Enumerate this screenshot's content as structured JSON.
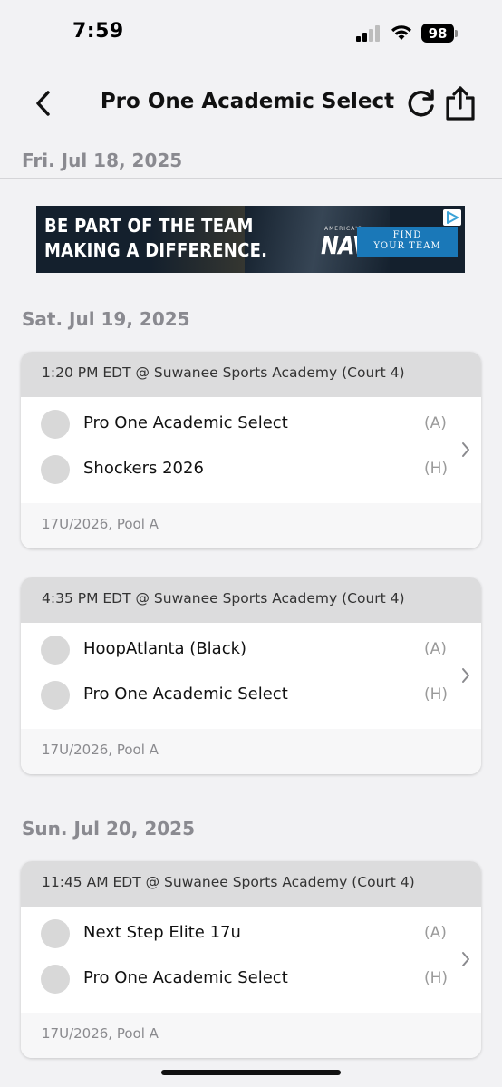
{
  "status_bar": {
    "time": "7:59",
    "battery": "98"
  },
  "nav": {
    "title": "Pro One Academic Select"
  },
  "ad": {
    "headline_line1": "BE PART OF THE TEAM",
    "headline_line2": "MAKING A DIFFERENCE.",
    "brand_small": "AMERICA'S",
    "brand": "NAVY",
    "cta_line1": "FIND",
    "cta_line2": "YOUR TEAM"
  },
  "days": [
    {
      "date": "Fri. Jul 18, 2025",
      "games": []
    },
    {
      "date": "Sat. Jul 19, 2025",
      "games": [
        {
          "header": "1:20 PM EDT @ Suwanee Sports Academy (Court 4)",
          "teams": [
            {
              "name": "Pro One Academic Select",
              "side": "(A)"
            },
            {
              "name": "Shockers 2026",
              "side": "(H)"
            }
          ],
          "footer": "17U/2026, Pool A"
        },
        {
          "header": "4:35 PM EDT @ Suwanee Sports Academy (Court 4)",
          "teams": [
            {
              "name": "HoopAtlanta (Black)",
              "side": "(A)"
            },
            {
              "name": "Pro One Academic Select",
              "side": "(H)"
            }
          ],
          "footer": "17U/2026, Pool A"
        }
      ]
    },
    {
      "date": "Sun. Jul 20, 2025",
      "games": [
        {
          "header": "11:45 AM EDT @ Suwanee Sports Academy (Court 4)",
          "teams": [
            {
              "name": "Next Step Elite 17u",
              "side": "(A)"
            },
            {
              "name": "Pro One Academic Select",
              "side": "(H)"
            }
          ],
          "footer": "17U/2026, Pool A"
        }
      ]
    }
  ]
}
